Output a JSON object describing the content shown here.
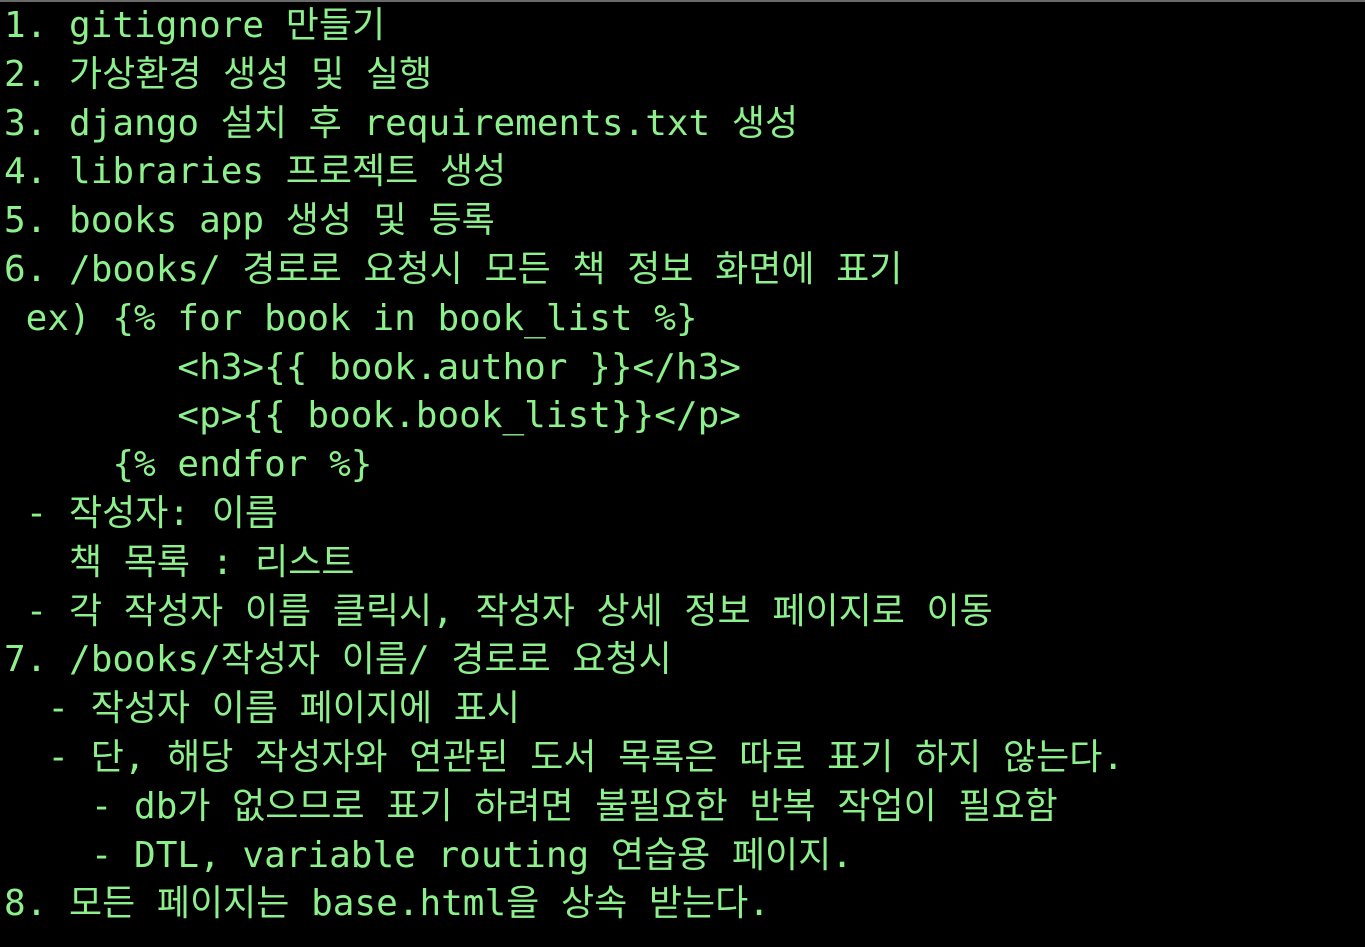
{
  "terminal": {
    "text_color": "#8df08d",
    "background": "#000000",
    "lines": [
      "1. gitignore 만들기",
      "2. 가상환경 생성 및 실행",
      "3. django 설치 후 requirements.txt 생성",
      "4. libraries 프로젝트 생성",
      "5. books app 생성 및 등록",
      "6. /books/ 경로로 요청시 모든 책 정보 화면에 표기",
      " ex) {% for book in book_list %}",
      "        <h3>{{ book.author }}</h3>",
      "        <p>{{ book.book_list}}</p>",
      "     {% endfor %}",
      " - 작성자: 이름",
      "   책 목록 : 리스트",
      " - 각 작성자 이름 클릭시, 작성자 상세 정보 페이지로 이동",
      "7. /books/작성자 이름/ 경로로 요청시",
      "  - 작성자 이름 페이지에 표시",
      "  - 단, 해당 작성자와 연관된 도서 목록은 따로 표기 하지 않는다.",
      "    - db가 없으므로 표기 하려면 불필요한 반복 작업이 필요함",
      "    - DTL, variable routing 연습용 페이지.",
      "8. 모든 페이지는 base.html을 상속 받는다."
    ]
  }
}
